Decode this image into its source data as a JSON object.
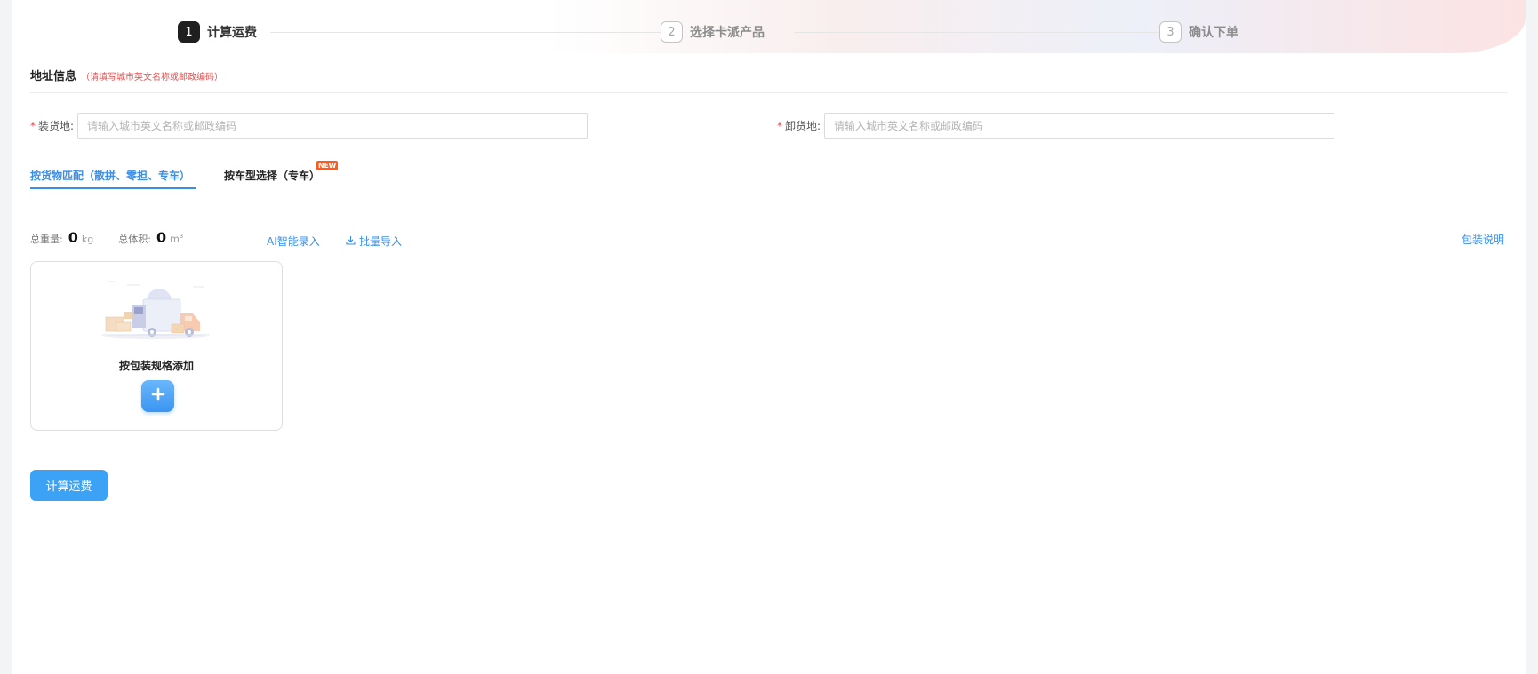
{
  "steps": [
    {
      "num": "1",
      "label": "计算运费",
      "state": "active"
    },
    {
      "num": "2",
      "label": "选择卡派产品",
      "state": "inactive"
    },
    {
      "num": "3",
      "label": "确认下单",
      "state": "inactive"
    }
  ],
  "address": {
    "title": "地址信息",
    "hint": "（请填写城市英文名称或邮政编码）",
    "required_mark": "*",
    "origin": {
      "label": "装货地:",
      "placeholder": "请输入城市英文名称或邮政编码",
      "value": ""
    },
    "destination": {
      "label": "卸货地:",
      "placeholder": "请输入城市英文名称或邮政编码",
      "value": ""
    }
  },
  "tabs": [
    {
      "label": "按货物匹配（散拼、零担、专车）",
      "active": true
    },
    {
      "label": "按车型选择（专车）",
      "active": false,
      "badge": "NEW"
    }
  ],
  "summary": {
    "weight_label": "总重量:",
    "weight_value": "0",
    "weight_unit": "kg",
    "volume_label": "总体积:",
    "volume_value": "0",
    "volume_unit": "m",
    "volume_unit_sup": "3"
  },
  "actions": {
    "ai_entry": "AI智能录入",
    "bulk_import": "批量导入",
    "packaging_info": "包装说明"
  },
  "card": {
    "title": "按包装规格添加",
    "add_icon": "plus-icon"
  },
  "calc_button": "计算运费",
  "colors": {
    "accent": "#3a8ee6",
    "button": "#3ba2f6",
    "required": "#e54545",
    "step_active": "#1f1f1f"
  }
}
